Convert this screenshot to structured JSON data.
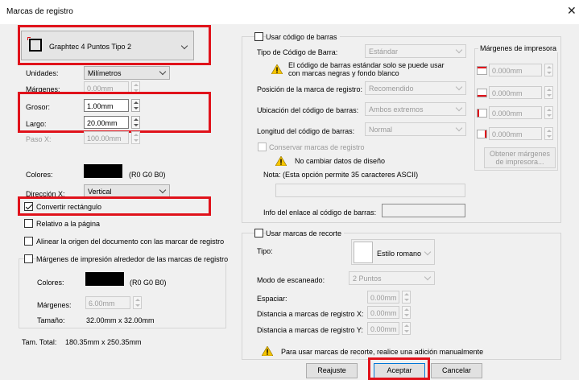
{
  "window": {
    "title": "Marcas de registro",
    "close_glyph": "✕"
  },
  "left": {
    "preset": "Graphtec 4 Puntos Tipo 2",
    "unidades": {
      "label": "Unidades:",
      "value": "Milímetros"
    },
    "margenes": {
      "label": "Márgenes:",
      "value": "0.00mm"
    },
    "grosor": {
      "label": "Grosor:",
      "value": "1.00mm"
    },
    "largo": {
      "label": "Largo:",
      "value": "20.00mm"
    },
    "pasox": {
      "label": "Paso X:",
      "value": "100.00mm"
    },
    "colores": {
      "label": "Colores:",
      "value": "(R0 G0 B0)",
      "swatch": "#000000"
    },
    "direccion": {
      "label": "Dirección X:",
      "value": "Vertical"
    },
    "convertir": {
      "label": "Convertir rectángulo",
      "checked": true
    },
    "relativo": {
      "label": "Relativo a la página",
      "checked": false
    },
    "alinear": {
      "label": "Alinear la origen del documento con las marcar de registro",
      "checked": false
    },
    "margenes_impresion": {
      "label": "Márgenes de impresión alrededor de las marcas de registro",
      "checked": false
    },
    "sub": {
      "colores": {
        "label": "Colores:",
        "value": "(R0 G0 B0)"
      },
      "margenes": {
        "label": "Márgenes:",
        "value": "6.00mm"
      },
      "tamano": {
        "label": "Tamaño:",
        "value": "32.00mm x 32.00mm"
      }
    },
    "total": {
      "label": "Tam. Total:",
      "value": "180.35mm x 250.35mm"
    }
  },
  "barcode": {
    "use_label": "Usar código de barras",
    "tipo": {
      "label": "Tipo de Código de Barra:",
      "value": "Estándar"
    },
    "warning": "El código de barras estándar solo se puede usar con marcas negras y fondo blanco",
    "posicion": {
      "label": "Posición de la marca de registro:",
      "value": "Recomendido"
    },
    "ubicacion": {
      "label": "Ubicación del código de barras:",
      "value": "Ambos extremos"
    },
    "longitud": {
      "label": "Longitud del código de barras:",
      "value": "Normal"
    },
    "conservar": "Conservar marcas de registro",
    "nocambiar": "No cambiar datos de diseño",
    "nota": "Nota: (Esta opción permite 35 caracteres ASCII)",
    "info": "Info del enlace al código de barras:"
  },
  "margins": {
    "title": "Márgenes de impresora",
    "values": [
      "0.000mm",
      "0.000mm",
      "0.000mm",
      "0.000mm"
    ],
    "obtain": "Obtener márgenes de impresora..."
  },
  "crop": {
    "use_label": "Usar marcas de recorte",
    "tipo": {
      "label": "Tipo:",
      "value": "Estilo romano"
    },
    "modo": {
      "label": "Modo de escaneado:",
      "value": "2 Puntos"
    },
    "espaciar": {
      "label": "Espaciar:",
      "value": "0.00mm"
    },
    "dist_x": {
      "label": "Distancia a marcas de registro X:",
      "value": "0.00mm"
    },
    "dist_y": {
      "label": "Distancia a marcas de registro Y:",
      "value": "0.00mm"
    },
    "note": "Para usar marcas de recorte, realice una adición manualmente"
  },
  "buttons": {
    "reset": "Reajuste",
    "ok": "Aceptar",
    "cancel": "Cancelar"
  },
  "colors": {
    "highlight": "#e0121b",
    "swatch": "#000000",
    "warning": "#f5c400"
  }
}
